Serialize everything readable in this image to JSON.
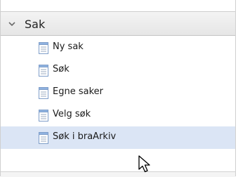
{
  "section": {
    "title": "Sak",
    "expanded": true,
    "icon": "chevron-down-icon"
  },
  "items": [
    {
      "label": "Ny sak",
      "icon": "document-icon",
      "selected": false
    },
    {
      "label": "Søk",
      "icon": "document-icon",
      "selected": false
    },
    {
      "label": "Egne saker",
      "icon": "document-icon",
      "selected": false
    },
    {
      "label": "Velg søk",
      "icon": "document-icon",
      "selected": false
    },
    {
      "label": "Søk i braArkiv",
      "icon": "document-icon",
      "selected": true
    }
  ],
  "colors": {
    "selected_bg": "#dbe5f5",
    "header_bg": "#e9e9e9",
    "icon_accent": "#5b8fd1"
  },
  "cursor": {
    "icon": "mouse-pointer-icon"
  }
}
